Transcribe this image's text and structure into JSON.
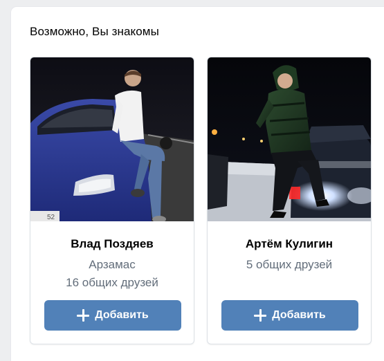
{
  "section": {
    "title": "Возможно, Вы знакомы"
  },
  "cards": [
    {
      "name": "Влад Поздяев",
      "city": "Арзамас",
      "mutual": "16 общих друзей",
      "button_label": "Добавить",
      "plate_text": "52"
    },
    {
      "name": "Артём Кулигин",
      "mutual": "5 общих друзей",
      "button_label": "Добавить"
    }
  ],
  "colors": {
    "accent": "#5181b8",
    "secondary_text": "#626d7a",
    "background": "#edeef0"
  }
}
